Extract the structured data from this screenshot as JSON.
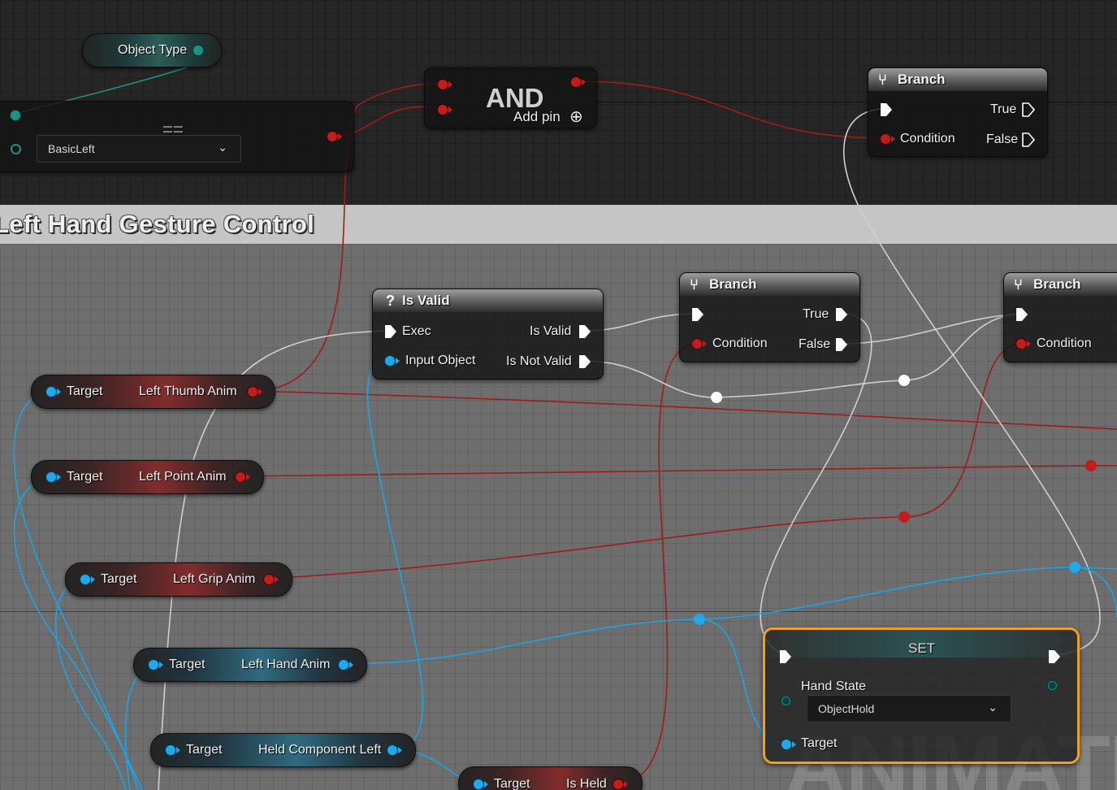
{
  "comment": {
    "title": "Left Hand Gesture Control"
  },
  "nodes": {
    "object_type": {
      "output": "Object Type"
    },
    "enum_select": {
      "value": "BasicLeft",
      "symbol": "=="
    },
    "and": {
      "title": "AND",
      "add_pin": "Add pin",
      "add_icon": "⊕"
    },
    "branch_top": {
      "title": "Branch",
      "condition": "Condition",
      "true": "True",
      "false": "False"
    },
    "is_valid": {
      "title": "Is Valid",
      "icon": "?",
      "exec": "Exec",
      "input_object": "Input Object",
      "is_valid": "Is Valid",
      "is_not_valid": "Is Not Valid"
    },
    "branch_mid": {
      "title": "Branch",
      "condition": "Condition",
      "true": "True",
      "false": "False"
    },
    "branch_right": {
      "title": "Branch",
      "condition": "Condition"
    },
    "getters": [
      {
        "target": "Target",
        "output": "Left Thumb Anim"
      },
      {
        "target": "Target",
        "output": "Left Point Anim"
      },
      {
        "target": "Target",
        "output": "Left Grip Anim"
      },
      {
        "target": "Target",
        "output": "Left Hand Anim"
      },
      {
        "target": "Target",
        "output": "Held Component Left"
      },
      {
        "target": "Target",
        "output": "Is Held"
      }
    ],
    "set": {
      "title": "SET",
      "field": "Hand State",
      "value": "ObjectHold",
      "target": "Target"
    }
  },
  "watermark": "ANIMATION",
  "colors": {
    "bool_pin": "#c11d1d",
    "object_pin": "#1fa8ea",
    "enum_pin": "#1d9184",
    "exec": "#ffffff",
    "selected": "#f0a020"
  }
}
